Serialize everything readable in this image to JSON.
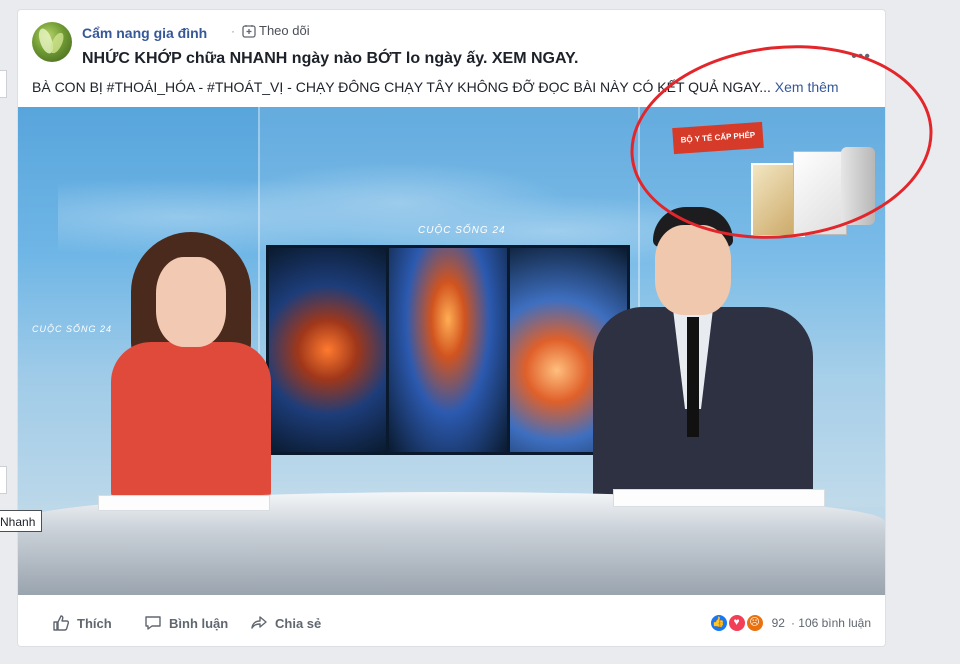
{
  "post": {
    "page_name": "Cẩm nang gia đình",
    "separator": "·",
    "follow_label": "Theo dõi",
    "headline": "NHỨC KHỚP chữa NHANH ngày nào BỚT lo ngày ấy. XEM NGAY.",
    "body_text": "BÀ CON BỊ #THOÁI_HÓA - #THOÁT_VỊ - CHẠY ĐÔNG CHẠY TÂY KHÔNG ĐỠ ĐỌC BÀI NÀY CÓ KẾT QUẢ NGAY...",
    "see_more": "Xem thêm",
    "more_icon": "•••"
  },
  "video": {
    "brand": "CUỘC SỐNG 24",
    "product_tag": "BỘ Y TẾ CẤP PHÉP"
  },
  "actions": {
    "like": "Thích",
    "comment": "Bình luận",
    "share": "Chia sẻ"
  },
  "reactions": {
    "count": "92",
    "comments": "· 106 bình luận"
  },
  "tooltip": "Nhanh",
  "colors": {
    "link": "#365899",
    "annotation": "#e2262b"
  }
}
